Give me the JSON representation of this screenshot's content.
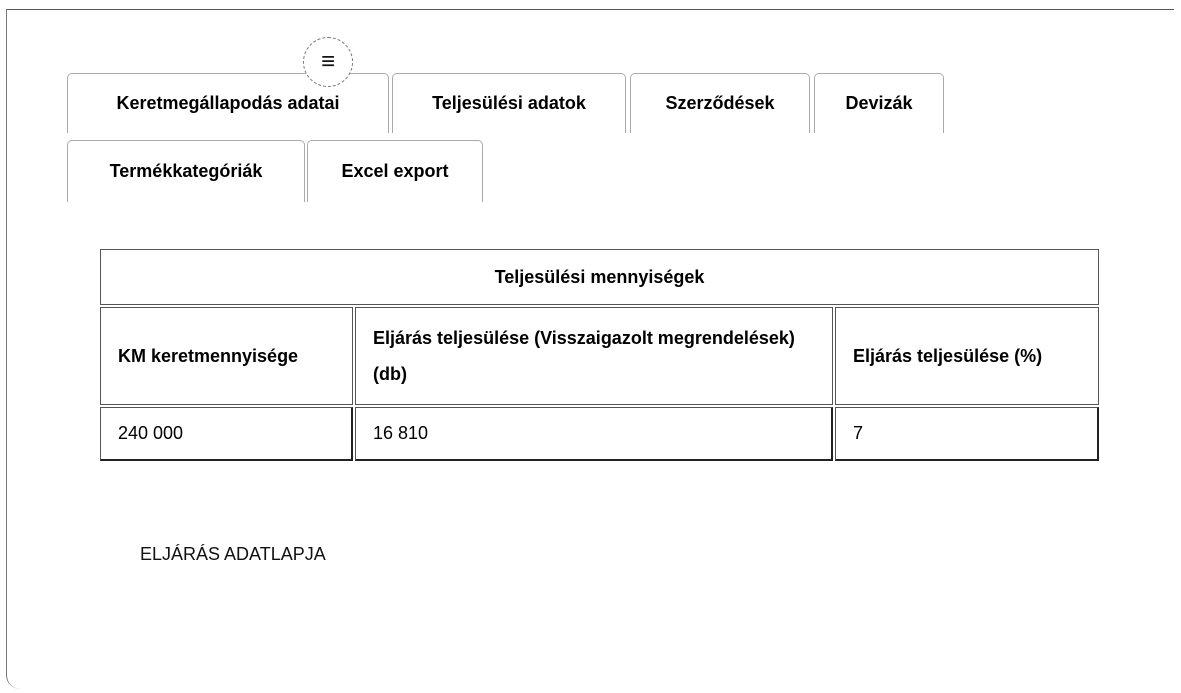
{
  "tabs": [
    {
      "label": "Keretmegállapodás adatai"
    },
    {
      "label": "Teljesülési adatok"
    },
    {
      "label": "Szerződések"
    },
    {
      "label": "Devizák"
    },
    {
      "label": "Termékkategóriák"
    },
    {
      "label": "Excel export"
    }
  ],
  "menu_icon": "hamburger-menu-icon",
  "table": {
    "title": "Teljesülési mennyiségek",
    "columns": [
      "KM keretmennyisége",
      "Eljárás teljesülése (Visszaigazolt megrendelések) (db)",
      "Eljárás teljesülése (%)"
    ],
    "rows": [
      [
        "240 000",
        "16 810",
        "7"
      ]
    ]
  },
  "section": {
    "label": "ELJÁRÁS ADATLAPJA"
  }
}
